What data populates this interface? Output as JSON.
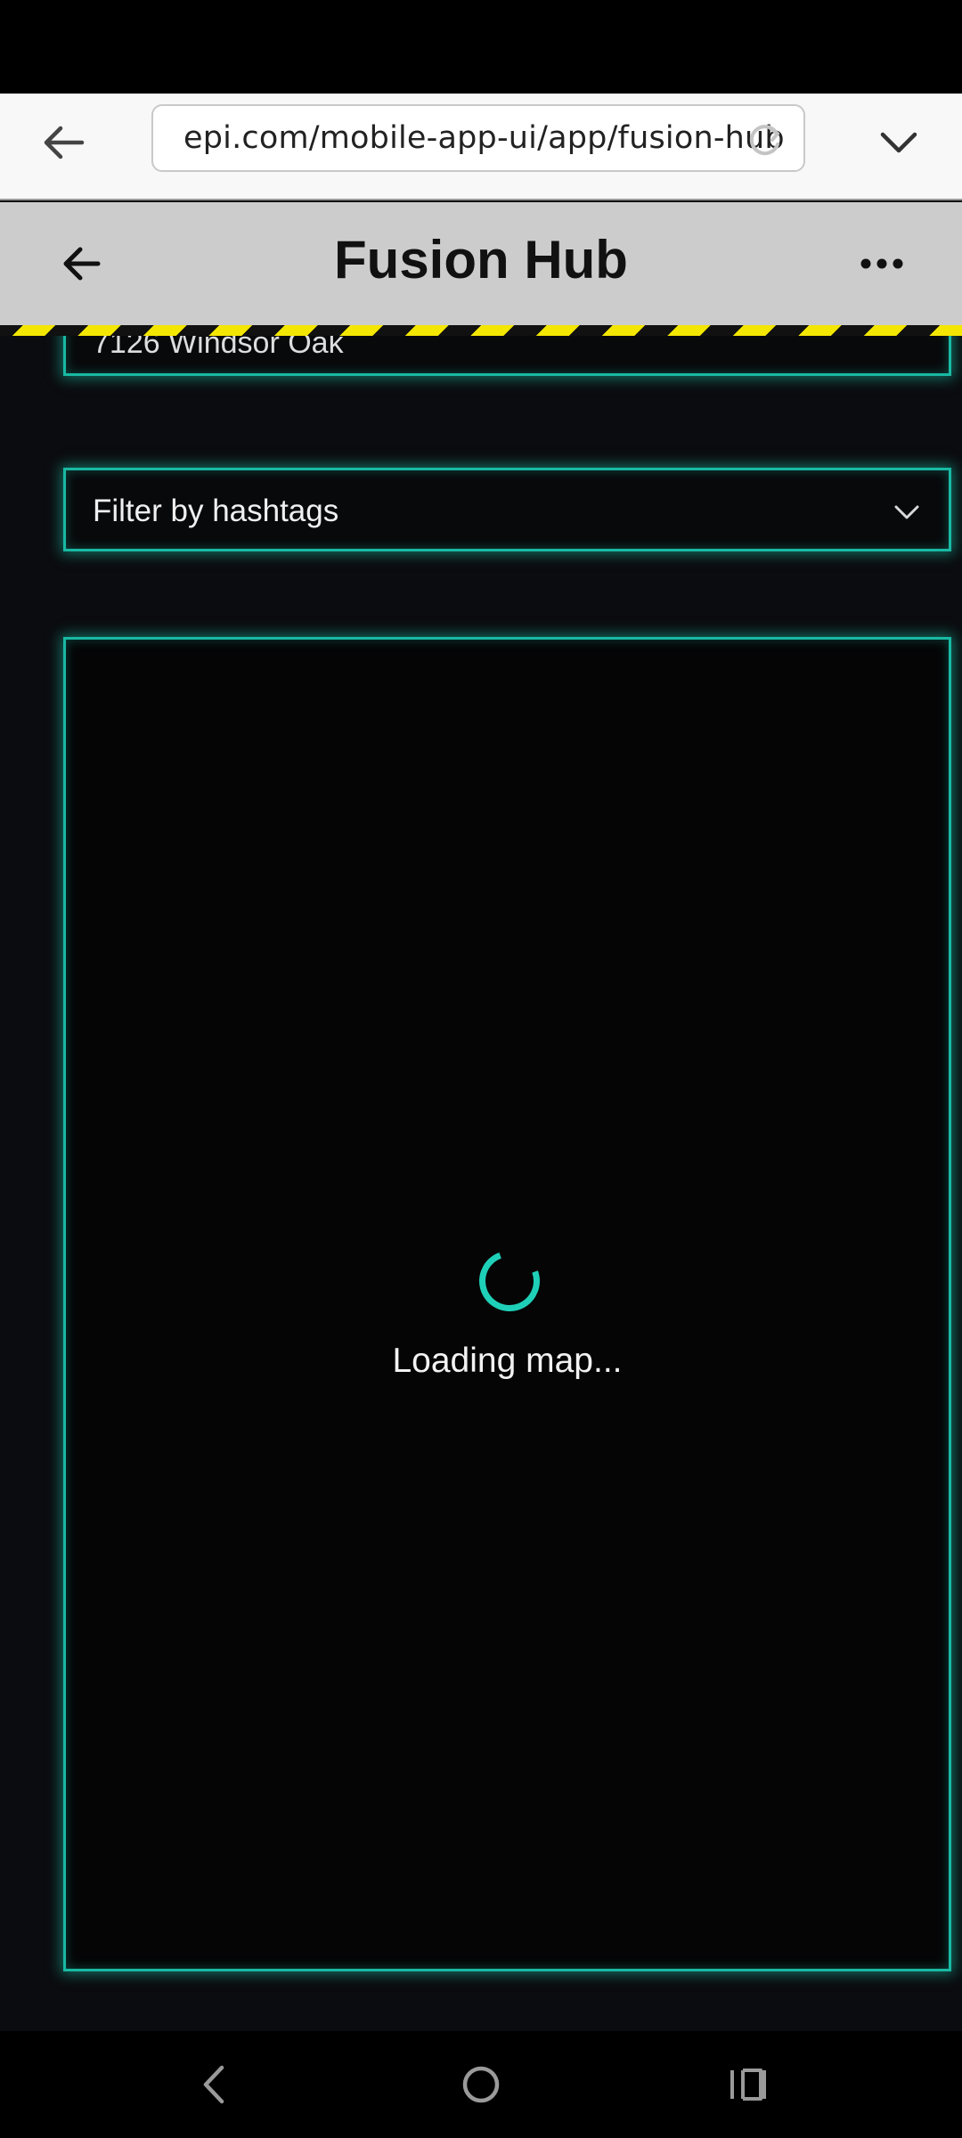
{
  "browser": {
    "url": "epi.com/mobile-app-ui/app/fusion-hub",
    "icons": {
      "back": "arrow-left-icon",
      "reload": "reload-icon",
      "menu": "chevron-down-icon"
    }
  },
  "header": {
    "title": "Fusion Hub",
    "icons": {
      "back": "arrow-left-icon",
      "more": "more-horizontal-icon"
    }
  },
  "address_card": {
    "text": "7126 Windsor Oak"
  },
  "hashtag_filter": {
    "label": "Filter by hashtags",
    "icon": "chevron-down-icon"
  },
  "map": {
    "status_text": "Loading map...",
    "spinner_icon": "loading-spinner-icon"
  },
  "system_nav": {
    "icons": [
      "back-icon",
      "home-icon",
      "recents-icon"
    ]
  },
  "colors": {
    "accent": "#19b9a3",
    "header_bg": "#cccccc",
    "stripe_yellow": "#f3e600",
    "background": "#0b0c0f"
  }
}
